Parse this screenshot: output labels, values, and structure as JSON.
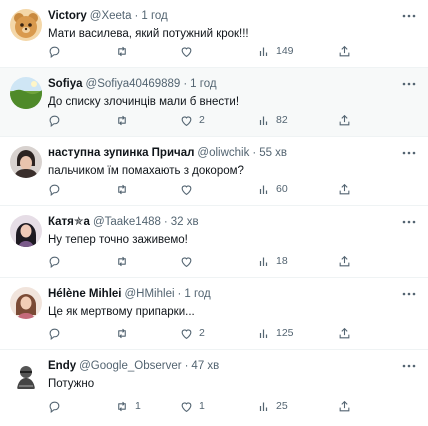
{
  "tweets": [
    {
      "name": "Victory",
      "handle": "@Xeeta",
      "dot": "·",
      "time": "1 год",
      "text": "Мати василева, який потужний крок!!!",
      "retweets": "",
      "likes": "",
      "views": "149",
      "avatar_icon": "bear-avatar",
      "highlighted": false
    },
    {
      "name": "Sofiya",
      "handle": "@Sofiya40469889",
      "dot": "·",
      "time": "1 год",
      "text": "До списку злочинців мали б внести!",
      "retweets": "",
      "likes": "2",
      "views": "82",
      "avatar_icon": "landscape-avatar",
      "highlighted": true
    },
    {
      "name": "наступна зупинка Причал",
      "handle": "@oliwchik",
      "dot": "·",
      "time": "55 хв",
      "text": "пальчиком їм помахають з докором?",
      "retweets": "",
      "likes": "",
      "views": "60",
      "avatar_icon": "person-avatar",
      "highlighted": false
    },
    {
      "name": "Катя✯а",
      "handle": "@Taake1488",
      "dot": "·",
      "time": "32 хв",
      "text": "Ну тепер точно заживемо!",
      "retweets": "",
      "likes": "",
      "views": "18",
      "avatar_icon": "person-avatar",
      "highlighted": false
    },
    {
      "name": "Hélène Mihlei",
      "handle": "@HMihlei",
      "dot": "·",
      "time": "1 год",
      "text": "Це як мертвому припарки...",
      "retweets": "",
      "likes": "2",
      "views": "125",
      "avatar_icon": "person-avatar",
      "highlighted": false
    },
    {
      "name": "Endy",
      "handle": "@Google_Observer",
      "dot": "·",
      "time": "47 хв",
      "text": "Потужно",
      "retweets": "1",
      "likes": "1",
      "views": "25",
      "avatar_icon": "character-avatar",
      "highlighted": false
    }
  ],
  "colors": {
    "text": "#0f1419",
    "muted": "#536471",
    "divider": "#eff3f4",
    "highlight_bg": "#f7f9f9"
  },
  "icons": [
    "more-icon",
    "reply-icon",
    "retweet-icon",
    "like-icon",
    "views-icon",
    "share-icon"
  ]
}
